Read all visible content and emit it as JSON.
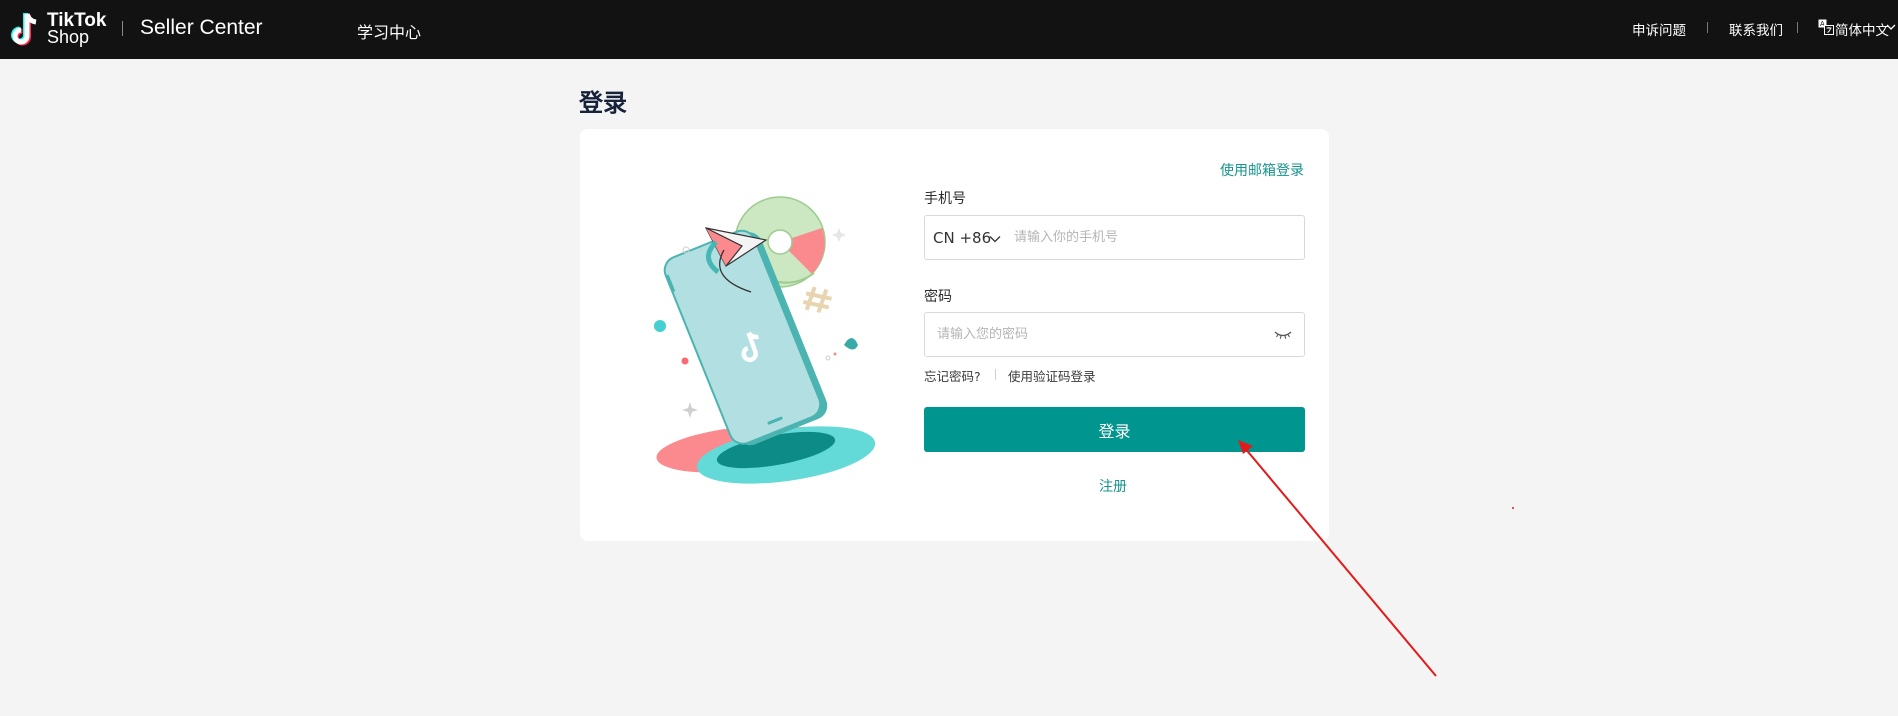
{
  "header": {
    "logo_line1": "TikTok",
    "logo_line2": "Shop",
    "product": "Seller Center",
    "nav_learning": "学习中心",
    "appeal": "申诉问题",
    "contact": "联系我们",
    "language": "简体中文"
  },
  "page": {
    "title": "登录"
  },
  "form": {
    "email_login_link": "使用邮箱登录",
    "phone_label": "手机号",
    "country_code": "CN +86",
    "phone_placeholder": "请输入你的手机号",
    "password_label": "密码",
    "password_placeholder": "请输入您的密码",
    "forgot_password": "忘记密码?",
    "code_login": "使用验证码登录",
    "login_button": "登录",
    "register_link": "注册"
  },
  "colors": {
    "accent": "#00968f",
    "link": "#16948d",
    "topbar": "#121212",
    "annotation_arrow": "#e21a1a"
  },
  "icons": {
    "logo": "tiktok-note-icon",
    "language": "translate-icon",
    "chevron": "chevron-down-icon",
    "password_toggle": "eye-closed-icon"
  }
}
